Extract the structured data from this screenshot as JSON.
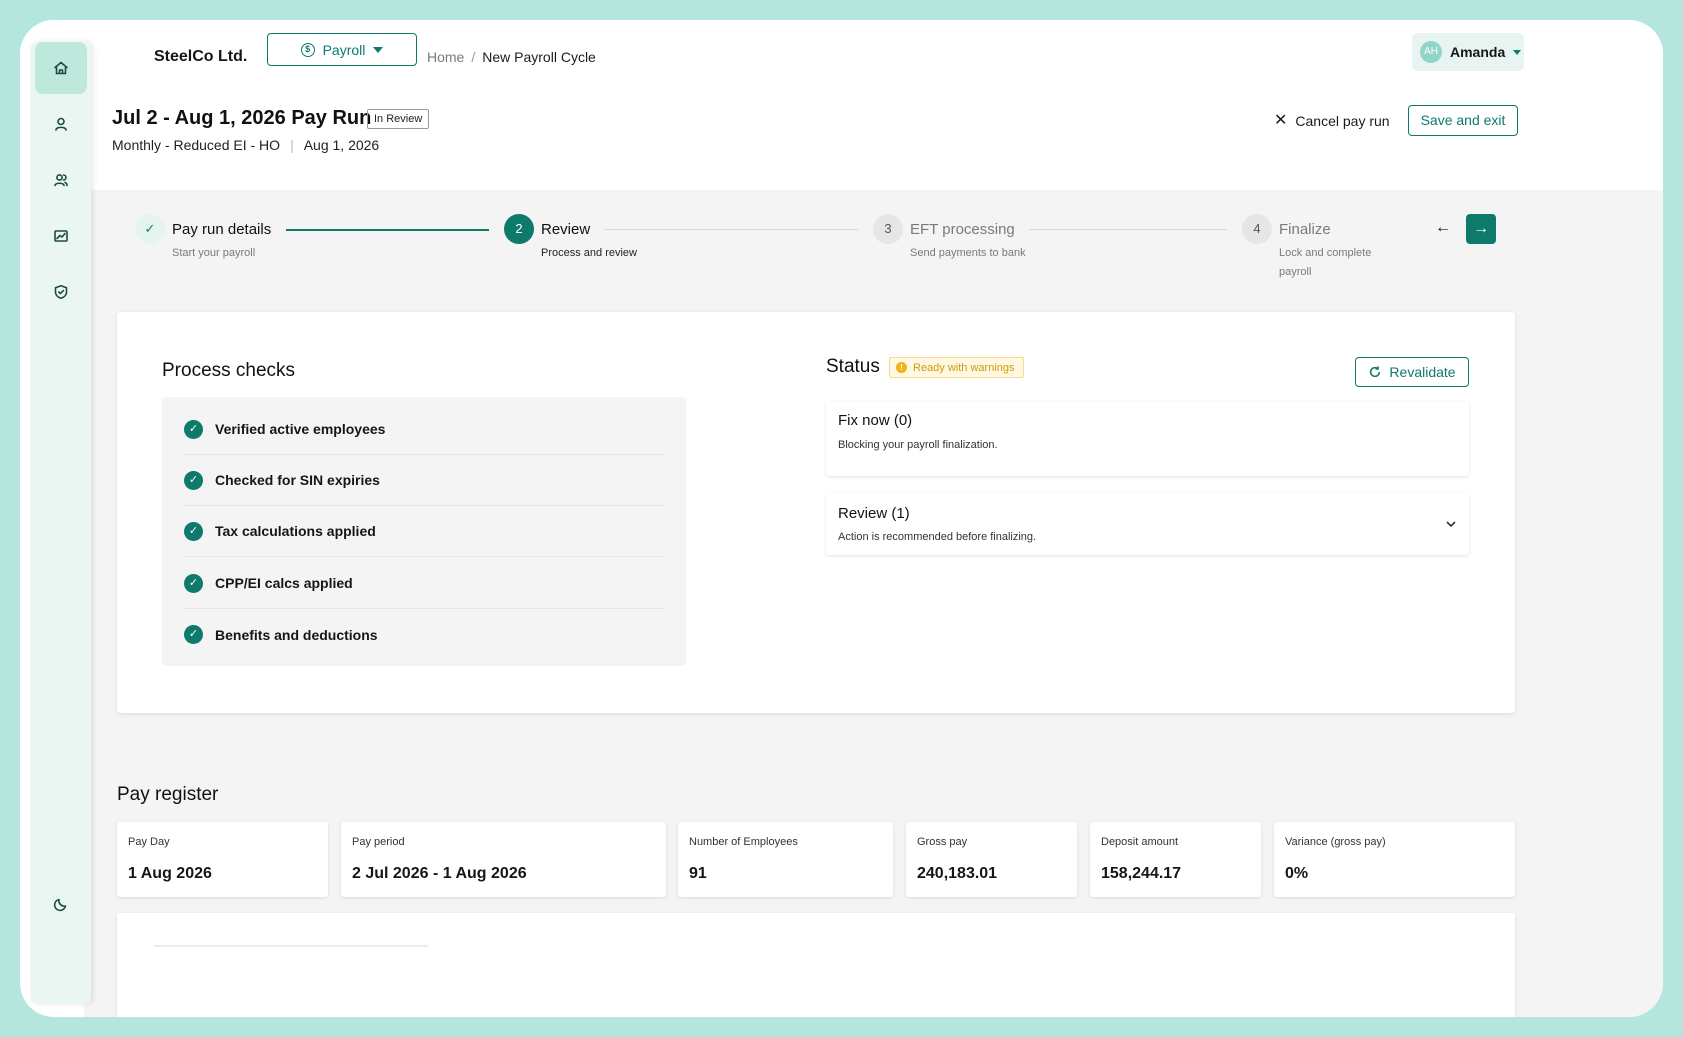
{
  "header": {
    "company": "SteelCo Ltd.",
    "module_label": "Payroll",
    "breadcrumb": {
      "home": "Home",
      "separator": "/",
      "current": "New Payroll Cycle"
    },
    "user": {
      "initials": "AH",
      "name": "Amanda"
    }
  },
  "sidebar": {
    "items": [
      {
        "icon": "home-icon",
        "active": true
      },
      {
        "icon": "user-icon",
        "active": false
      },
      {
        "icon": "users-icon",
        "active": false
      },
      {
        "icon": "chart-icon",
        "active": false
      },
      {
        "icon": "shield-icon",
        "active": false
      }
    ],
    "bottom_icon": "moon-icon"
  },
  "payrun": {
    "title": "Jul 2 - Aug 1, 2026 Pay Run",
    "status_badge": "In Review",
    "schedule": "Monthly - Reduced EI - HO",
    "separator": "|",
    "pay_date": "Aug 1, 2026",
    "cancel_label": "Cancel pay run",
    "save_label": "Save and exit"
  },
  "stepper": {
    "steps": [
      {
        "number": "",
        "title": "Pay run details",
        "sub": "Start your payroll",
        "state": "done"
      },
      {
        "number": "2",
        "title": "Review",
        "sub": "Process and review",
        "state": "active"
      },
      {
        "number": "3",
        "title": "EFT processing",
        "sub": "Send payments to bank",
        "state": "todo"
      },
      {
        "number": "4",
        "title": "Finalize",
        "sub_line1": "Lock and complete",
        "sub_line2": "payroll",
        "state": "todo"
      }
    ],
    "done_icon": "check-icon",
    "prev_icon": "arrow-left-icon",
    "next_icon": "arrow-right-icon"
  },
  "process_checks": {
    "heading": "Process checks",
    "items": [
      "Verified active employees",
      "Checked for SIN expiries",
      "Tax calculations applied",
      "CPP/EI calcs applied",
      "Benefits and deductions"
    ]
  },
  "status": {
    "heading": "Status",
    "badge": "Ready with warnings",
    "revalidate_label": "Revalidate",
    "fix_now": {
      "title": "Fix now (0)",
      "description": "Blocking your payroll finalization."
    },
    "review": {
      "title": "Review (1)",
      "description": "Action is recommended before finalizing."
    }
  },
  "pay_register": {
    "heading": "Pay register",
    "stats": [
      {
        "label": "Pay Day",
        "value": "1 Aug 2026"
      },
      {
        "label": "Pay period",
        "value": "2 Jul 2026 - 1 Aug 2026"
      },
      {
        "label": "Number of Employees",
        "value": "91"
      },
      {
        "label": "Gross pay",
        "value": "240,183.01"
      },
      {
        "label": "Deposit amount",
        "value": "158,244.17"
      },
      {
        "label": "Variance (gross pay)",
        "value": "0%"
      }
    ]
  },
  "colors": {
    "accent": "#0d7a6c",
    "frame": "#b5e6de",
    "warning": "#efb31c",
    "sidebar": "#e9f6f2"
  }
}
